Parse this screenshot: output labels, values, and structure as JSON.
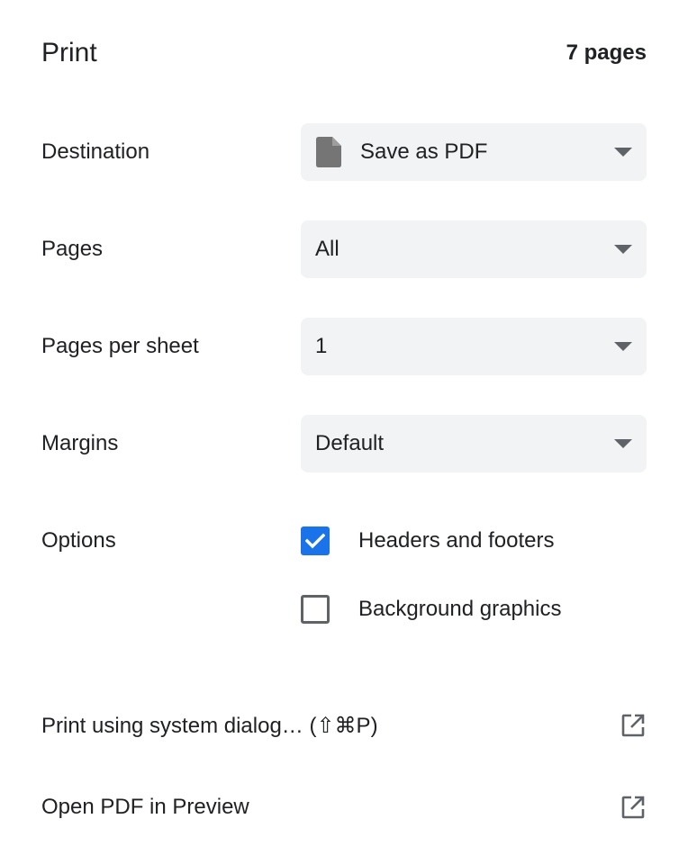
{
  "header": {
    "title": "Print",
    "page_count": "7 pages"
  },
  "settings": {
    "destination": {
      "label": "Destination",
      "value": "Save as PDF",
      "icon": "document-icon"
    },
    "pages": {
      "label": "Pages",
      "value": "All"
    },
    "pages_per_sheet": {
      "label": "Pages per sheet",
      "value": "1"
    },
    "margins": {
      "label": "Margins",
      "value": "Default"
    },
    "options": {
      "label": "Options",
      "items": [
        {
          "label": "Headers and footers",
          "checked": true
        },
        {
          "label": "Background graphics",
          "checked": false
        }
      ]
    }
  },
  "links": {
    "system_dialog": "Print using system dialog… (⇧⌘P)",
    "open_pdf": "Open PDF in Preview",
    "icon": "open-external-icon"
  },
  "colors": {
    "accent": "#1a73e8",
    "select_background": "#f1f3f4",
    "icon_gray": "#5f6368",
    "text": "#202124"
  }
}
